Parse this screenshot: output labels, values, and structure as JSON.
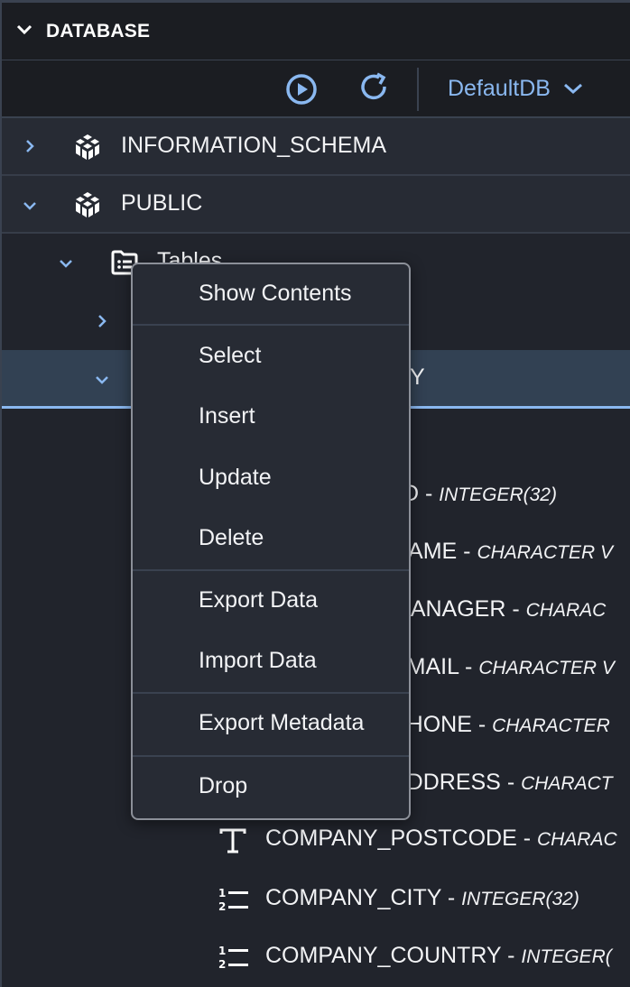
{
  "section": {
    "title": "DATABASE",
    "chevron_icon": "chevron-down-icon"
  },
  "toolbar": {
    "run_icon": "play-circle-icon",
    "refresh_icon": "refresh-icon",
    "database_selector": {
      "value": "DefaultDB",
      "icon": "chevron-down-icon"
    }
  },
  "tree": {
    "schemas": [
      {
        "label": "INFORMATION_SCHEMA",
        "expanded": false,
        "icon": "schema-cube-icon"
      },
      {
        "label": "PUBLIC",
        "expanded": true,
        "icon": "schema-cube-icon"
      }
    ],
    "tables_folder": {
      "label": "Tables",
      "expanded": true,
      "icon": "table-folder-icon"
    },
    "selected_table_label_suffix": "NY",
    "columns": [
      {
        "name_visible": "D",
        "type": "INTEGER(32)"
      },
      {
        "name_visible": "NAME",
        "type": "CHARACTER V"
      },
      {
        "name_visible": "MANAGER",
        "type": "CHARAC"
      },
      {
        "name_visible": "EMAIL",
        "type": "CHARACTER V"
      },
      {
        "name_visible": "PHONE",
        "type": "CHARACTER"
      },
      {
        "name_visible": "ADDRESS",
        "type": "CHARACT"
      },
      {
        "name_visible": "COMPANY_POSTCODE",
        "type": "CHARAC",
        "icon": "text-type-icon"
      },
      {
        "name_visible": "COMPANY_CITY",
        "type": "INTEGER(32)",
        "icon": "numeric-type-icon"
      },
      {
        "name_visible": "COMPANY_COUNTRY",
        "type": "INTEGER(",
        "icon": "numeric-type-icon"
      }
    ]
  },
  "context_menu": {
    "items": [
      {
        "label": "Show Contents"
      },
      {
        "label": "Select"
      },
      {
        "label": "Insert"
      },
      {
        "label": "Update"
      },
      {
        "label": "Delete"
      },
      {
        "label": "Export Data"
      },
      {
        "label": "Import Data"
      },
      {
        "label": "Export Metadata"
      },
      {
        "label": "Drop"
      }
    ]
  },
  "colors": {
    "accent": "#8ab8f0",
    "header_bg": "#1b1d22",
    "row_bg": "#272b34",
    "selected_row_bg": "#324153",
    "text": "#f2f3f5"
  }
}
